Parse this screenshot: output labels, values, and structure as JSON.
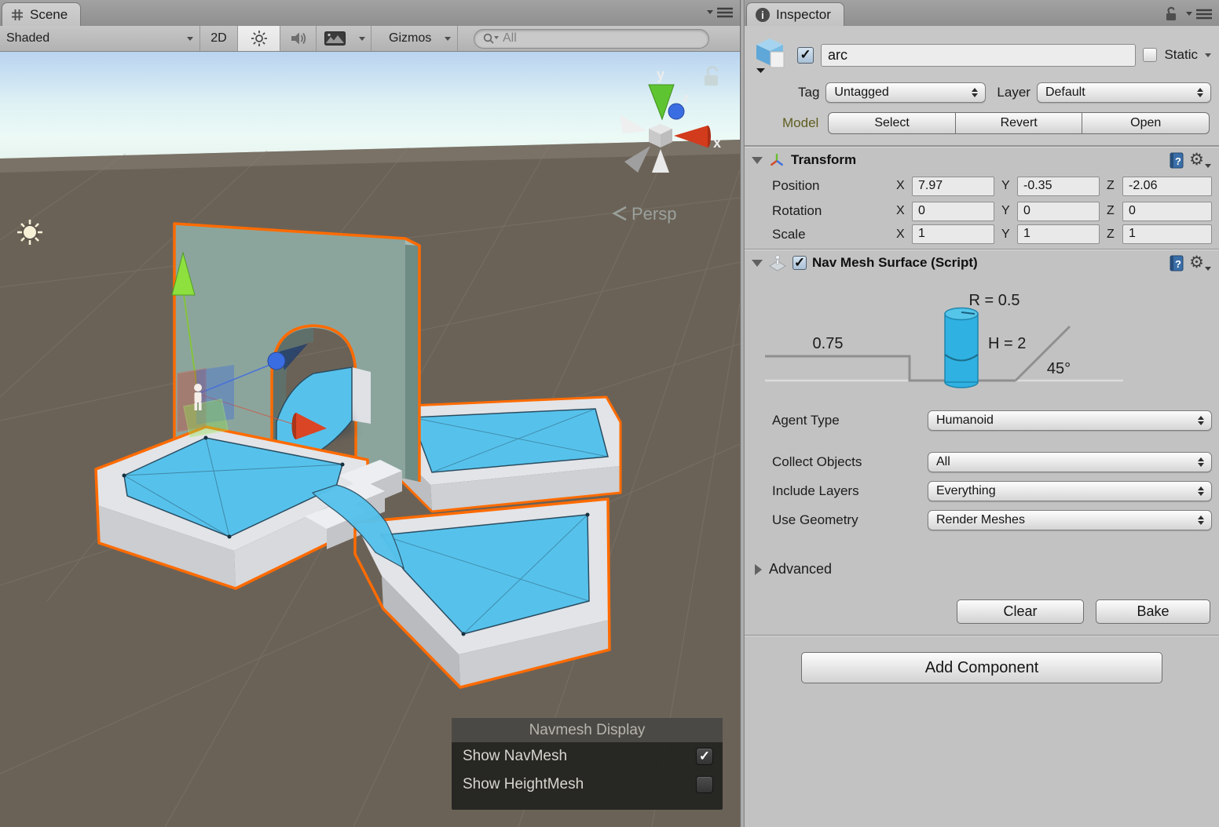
{
  "scene_panel": {
    "tab_label": "Scene",
    "toolbar": {
      "draw_mode": "Shaded",
      "mode_2d": "2D",
      "gizmos_label": "Gizmos",
      "search_placeholder": "All"
    },
    "viewport": {
      "projection_label": "Persp",
      "axis_gizmo": {
        "x": "x",
        "y": "y",
        "z": "z"
      }
    },
    "navmesh_display_overlay": {
      "title": "Navmesh Display",
      "options": [
        {
          "label": "Show NavMesh",
          "checked": true
        },
        {
          "label": "Show HeightMesh",
          "checked": false
        }
      ]
    }
  },
  "inspector": {
    "tab_label": "Inspector",
    "header": {
      "active_checked": true,
      "name": "arc",
      "static_label": "Static",
      "static_checked": false,
      "tag_label": "Tag",
      "tag_value": "Untagged",
      "layer_label": "Layer",
      "layer_value": "Default",
      "model_label": "Model",
      "model_buttons": [
        "Select",
        "Revert",
        "Open"
      ]
    },
    "transform": {
      "title": "Transform",
      "axis": [
        "X",
        "Y",
        "Z"
      ],
      "rows": [
        {
          "label": "Position",
          "x": "7.97",
          "y": "-0.35",
          "z": "-2.06"
        },
        {
          "label": "Rotation",
          "x": "0",
          "y": "0",
          "z": "0"
        },
        {
          "label": "Scale",
          "x": "1",
          "y": "1",
          "z": "1"
        }
      ]
    },
    "nav_mesh_surface": {
      "title": "Nav Mesh Surface (Script)",
      "enabled_checked": true,
      "diagram": {
        "radius_label": "R = 0.5",
        "step_height_label": "0.75",
        "agent_height_label": "H = 2",
        "max_slope_label": "45°"
      },
      "fields": [
        {
          "label": "Agent Type",
          "value": "Humanoid"
        },
        {
          "label": "Collect Objects",
          "value": "All"
        },
        {
          "label": "Include Layers",
          "value": "Everything"
        },
        {
          "label": "Use Geometry",
          "value": "Render Meshes"
        }
      ],
      "advanced_label": "Advanced",
      "clear_label": "Clear",
      "bake_label": "Bake"
    },
    "add_component_label": "Add Component"
  },
  "icons": {
    "scene_tab": "grid-icon",
    "inspector_tab": "info-icon",
    "lighting_toggle": "sun-icon",
    "audio_toggle": "speaker-icon",
    "effects_toggle": "image-icon",
    "search": "magnifier-icon",
    "panel_menu": "hamburger-menu-icon",
    "lock": "padlock-icon",
    "gameobject": "cube-icon",
    "transform_component": "axis-tripod-icon",
    "navmesh_component": "agent-on-plane-icon",
    "help": "help-book-icon",
    "settings": "gear-icon",
    "directional_light": "sun-gizmo",
    "agent_shape": "cylinder"
  },
  "colors": {
    "selection_outline": "#ff6b00",
    "navmesh_surface": "#56c2ec",
    "wall": "#8ba59d",
    "scene_ground": "#6b6257",
    "agent_cylinder": "#2fb1e2",
    "model_label": "#5f5d20",
    "panel_background": "#c2c2c2",
    "overlay_background": "#222220"
  }
}
